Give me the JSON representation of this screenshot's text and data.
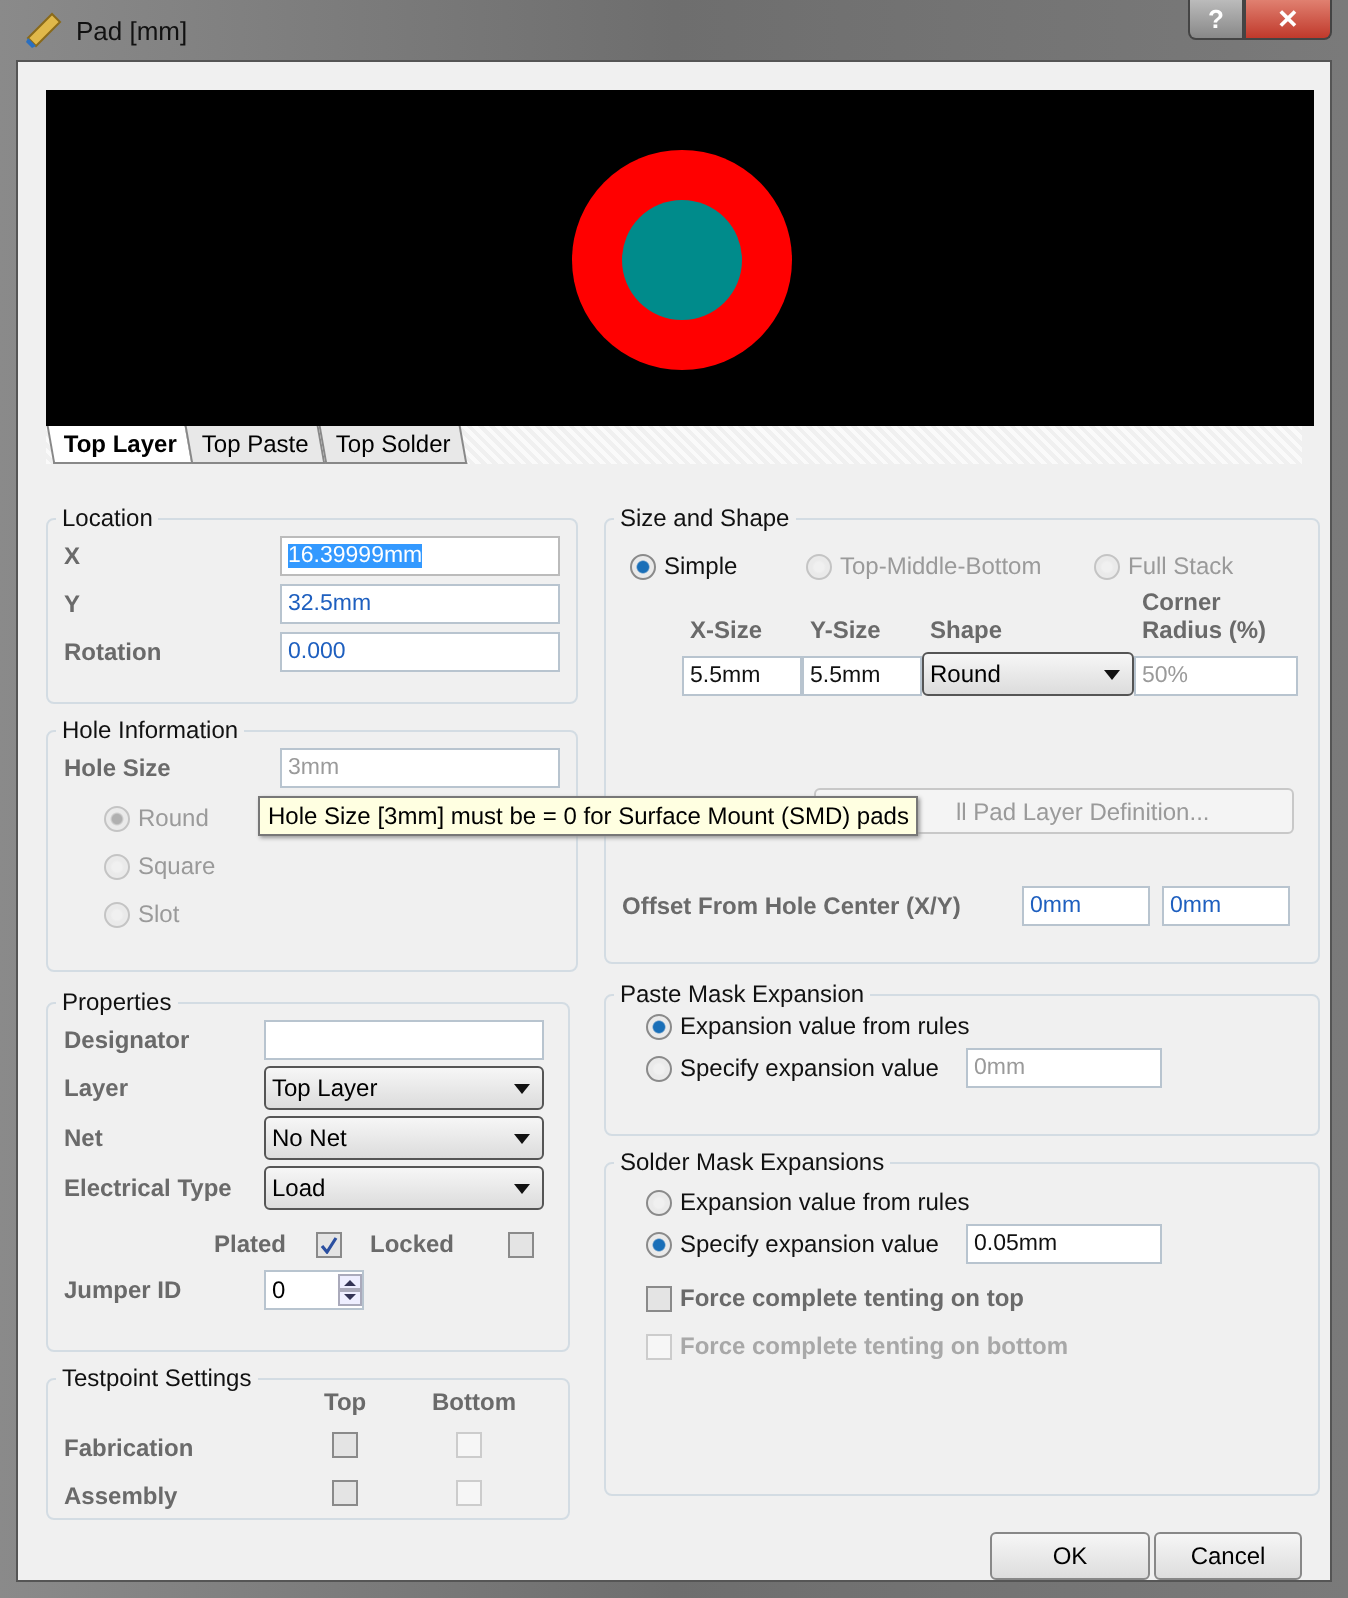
{
  "window": {
    "title": "Pad [mm]",
    "help_button": "?",
    "close_button": "✕"
  },
  "preview": {
    "kind": "picture"
  },
  "tabs": [
    {
      "label": "Top Layer",
      "selected": true
    },
    {
      "label": "Top Paste",
      "selected": false
    },
    {
      "label": "Top Solder",
      "selected": false
    }
  ],
  "location": {
    "title": "Location",
    "fields": [
      {
        "label": "X",
        "value": "16.39999mm",
        "selected": true
      },
      {
        "label": "Y",
        "value": "32.5mm",
        "selected": false
      },
      {
        "label": "Rotation",
        "value": "0.000",
        "selected": false
      }
    ]
  },
  "hole_information": {
    "title": "Hole Information",
    "label": "Hole Size",
    "value": "3mm",
    "disabled": true,
    "shapes": [
      {
        "label": "Round",
        "selected": true
      },
      {
        "label": "Square",
        "selected": false
      },
      {
        "label": "Slot",
        "selected": false
      }
    ]
  },
  "tooltip": "Hole Size [3mm] must be = 0 for Surface Mount (SMD) pads",
  "size_and_shape": {
    "title": "Size and Shape",
    "modes": [
      {
        "label": "Simple",
        "selected": true,
        "disabled": false
      },
      {
        "label": "Top-Middle-Bottom",
        "selected": false,
        "disabled": true
      },
      {
        "label": "Full Stack",
        "selected": false,
        "disabled": true
      }
    ],
    "columns": [
      "X-Size",
      "Y-Size",
      "Shape",
      "Corner Radius (%)"
    ],
    "x_size": "5.5mm",
    "y_size": "5.5mm",
    "shape": "Round",
    "corner_radius": "50%",
    "layer_button": "ll Pad Layer Definition...",
    "offset_label": "Offset From Hole Center (X/Y)",
    "offset_x": "0mm",
    "offset_y": "0mm"
  },
  "properties": {
    "title": "Properties",
    "designator_label": "Designator",
    "dropdowns": [
      {
        "label": "Layer",
        "value": "Top Layer"
      },
      {
        "label": "Net",
        "value": "No Net"
      },
      {
        "label": "Electrical Type",
        "value": "Load"
      }
    ],
    "plated": {
      "label": "Plated",
      "checked": true
    },
    "locked": {
      "label": "Locked",
      "checked": false
    },
    "jumper_label": "Jumper ID",
    "jumper_id": "0"
  },
  "testpoint": {
    "title": "Testpoint Settings",
    "columns": [
      "Top",
      "Bottom"
    ],
    "rows": [
      {
        "label": "Fabrication",
        "top": false,
        "bottom": false
      },
      {
        "label": "Assembly",
        "top": false,
        "bottom": false
      }
    ]
  },
  "paste_mask": {
    "title": "Paste Mask Expansion",
    "options": [
      {
        "label": "Expansion value from rules",
        "selected": true
      },
      {
        "label": "Specify expansion value",
        "selected": false
      }
    ],
    "value": "0mm"
  },
  "solder_mask": {
    "title": "Solder Mask Expansions",
    "options": [
      {
        "label": "Expansion value from rules",
        "selected": false
      },
      {
        "label": "Specify expansion value",
        "selected": true
      }
    ],
    "value": "0.05mm",
    "checks": [
      {
        "label": "Force complete tenting on top",
        "checked": false,
        "disabled": false
      },
      {
        "label": "Force complete tenting on bottom",
        "checked": false,
        "disabled": true
      }
    ]
  },
  "buttons": [
    "OK",
    "Cancel"
  ]
}
